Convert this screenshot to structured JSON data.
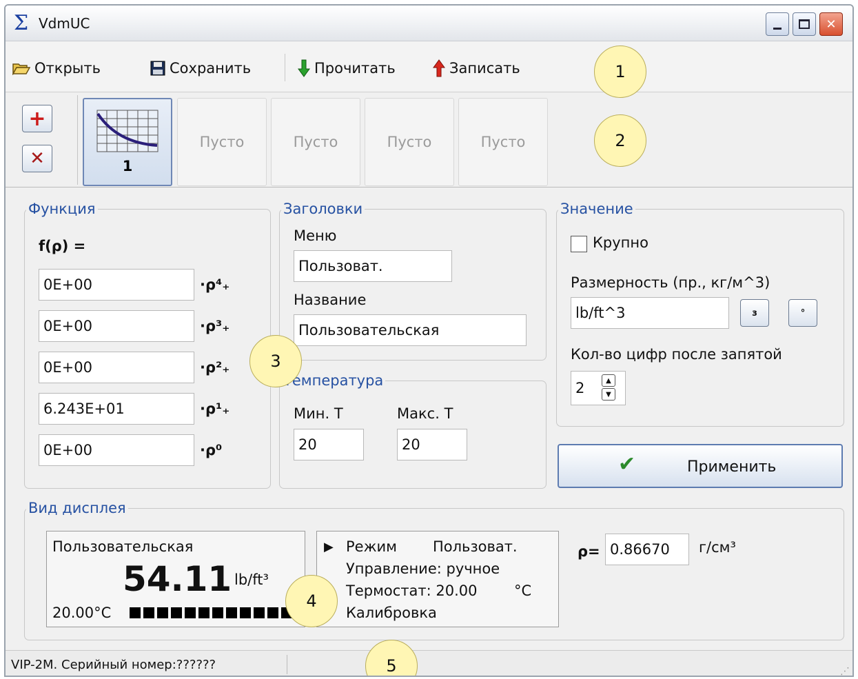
{
  "window": {
    "title": "VdmUC"
  },
  "toolbar": {
    "open_label": "Открыть",
    "save_label": "Сохранить",
    "read_label": "Прочитать",
    "write_label": "Записать"
  },
  "slots": {
    "active_label": "1",
    "empty_labels": [
      "Пусто",
      "Пусто",
      "Пусто",
      "Пусто"
    ]
  },
  "function_group": {
    "legend": "Функция",
    "formula_label": "f(ρ) =",
    "coefficients": [
      {
        "value": "0E+00",
        "power": "·ρ⁴₊"
      },
      {
        "value": "0E+00",
        "power": "·ρ³₊"
      },
      {
        "value": "0E+00",
        "power": "·ρ²₊"
      },
      {
        "value": "6.243E+01",
        "power": "·ρ¹₊"
      },
      {
        "value": "0E+00",
        "power": "·ρ⁰"
      }
    ]
  },
  "headers_group": {
    "legend": "Заголовки",
    "menu_label": "Меню",
    "menu_value": "Пользоват.",
    "name_label": "Название",
    "name_value": "Пользовательская"
  },
  "temperature_group": {
    "legend": "Температура",
    "min_label": "Мин. T",
    "min_value": "20",
    "max_label": "Макс. T",
    "max_value": "20"
  },
  "value_group": {
    "legend": "Значение",
    "large_label": "Крупно",
    "large_checked": false,
    "units_label": "Размерность (пр., кг/м^3)",
    "units_value": "lb/ft^3",
    "superscript3_label": "з",
    "degree_label": "°",
    "digits_label": "Кол-во цифр после запятой",
    "digits_value": "2"
  },
  "apply_label": "Применить",
  "display_group": {
    "legend": "Вид дисплея",
    "lcd_title": "Пользовательская",
    "lcd_value": "54.11",
    "lcd_unit": "lb/ft³",
    "lcd_temp": "20.00°C",
    "menu_lines": {
      "mode": "Режим",
      "mode_value": "Пользоват.",
      "control": "Управление: ручное",
      "thermostat": "Термостат: 20.00",
      "thermostat_unit": "°C",
      "calibration": "Калибровка"
    },
    "rho_label": "ρ=",
    "rho_value": "0.86670",
    "rho_unit": "г/см³"
  },
  "status": {
    "text": "VIP-2M. Серийный номер:??????"
  },
  "callouts": [
    "1",
    "2",
    "3",
    "4",
    "5"
  ],
  "colors": {
    "legend_blue": "#2651a2",
    "callout_fill": "#fff6b4"
  }
}
